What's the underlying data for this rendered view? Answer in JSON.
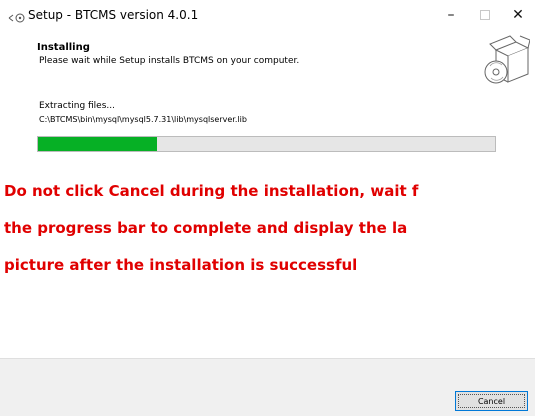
{
  "window": {
    "title": "Setup - BTCMS version 4.0.1",
    "minimize_glyph": "–",
    "maximize_glyph": "□",
    "close_glyph": "✕"
  },
  "header": {
    "title": "Installing",
    "subtitle": "Please wait while Setup installs BTCMS on your computer.",
    "icon": "installer-box-disc-icon"
  },
  "body": {
    "status": "Extracting files...",
    "current_file": "C:\\BTCMS\\bin\\mysql\\mysql5.7.31\\lib\\mysqlserver.lib",
    "progress": 0.26,
    "progress_color": "#06b025"
  },
  "note": {
    "line1": "Do not click Cancel during the installation, wait f",
    "line2": "the progress bar to complete and display the la",
    "line3": "picture after the installation is successful",
    "color": "#e00000"
  },
  "footer": {
    "cancel_label": "Cancel"
  }
}
